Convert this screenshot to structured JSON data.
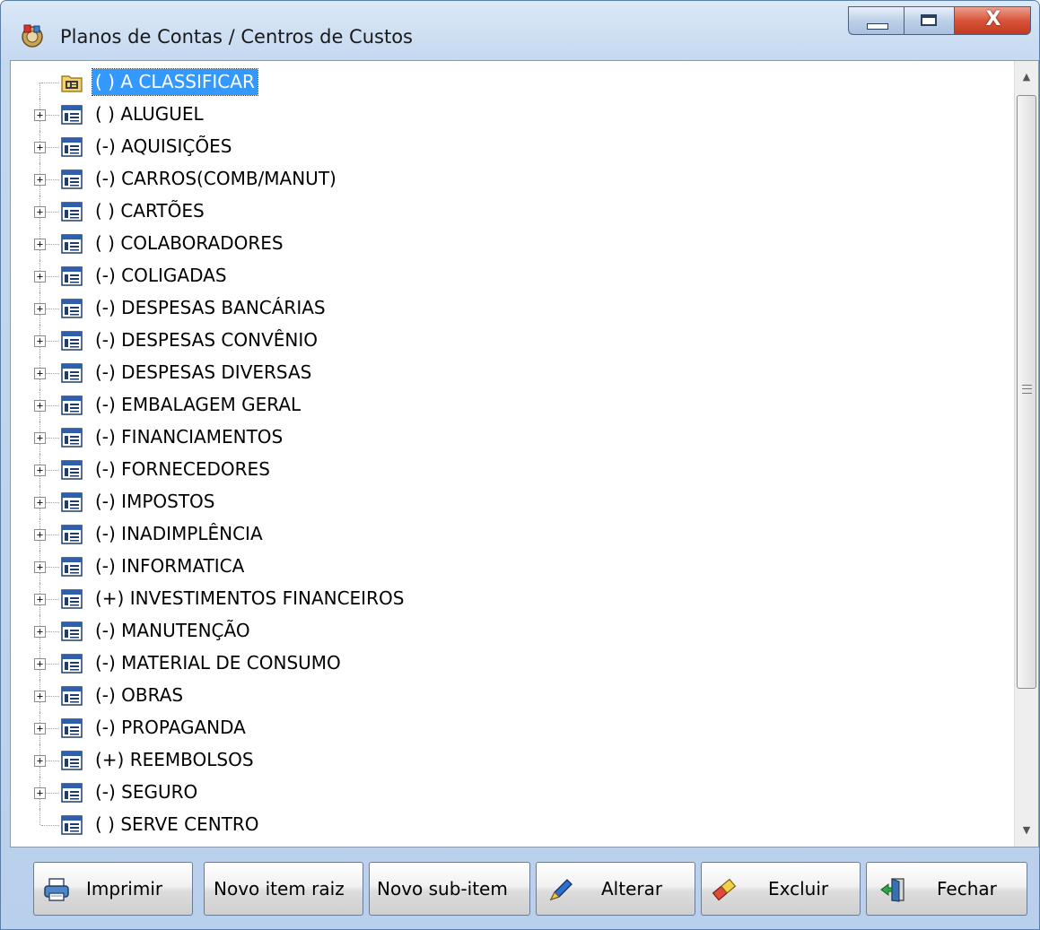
{
  "window": {
    "title": "Planos de Contas / Centros de Custos",
    "caption_close_glyph": "X"
  },
  "tree": {
    "items": [
      {
        "label": "( ) A CLASSIFICAR",
        "expandable": false,
        "selected": true,
        "icon": "folder-icon"
      },
      {
        "label": "( ) ALUGUEL",
        "expandable": true,
        "selected": false,
        "icon": "table-icon"
      },
      {
        "label": "(-) AQUISIÇÕES",
        "expandable": true,
        "selected": false,
        "icon": "table-icon"
      },
      {
        "label": "(-) CARROS(COMB/MANUT)",
        "expandable": true,
        "selected": false,
        "icon": "table-icon"
      },
      {
        "label": "( ) CARTÕES",
        "expandable": true,
        "selected": false,
        "icon": "table-icon"
      },
      {
        "label": "( ) COLABORADORES",
        "expandable": true,
        "selected": false,
        "icon": "table-icon"
      },
      {
        "label": "(-) COLIGADAS",
        "expandable": true,
        "selected": false,
        "icon": "table-icon"
      },
      {
        "label": "(-) DESPESAS BANCÁRIAS",
        "expandable": true,
        "selected": false,
        "icon": "table-icon"
      },
      {
        "label": "(-) DESPESAS CONVÊNIO",
        "expandable": true,
        "selected": false,
        "icon": "table-icon"
      },
      {
        "label": "(-) DESPESAS DIVERSAS",
        "expandable": true,
        "selected": false,
        "icon": "table-icon"
      },
      {
        "label": "(-) EMBALAGEM GERAL",
        "expandable": true,
        "selected": false,
        "icon": "table-icon"
      },
      {
        "label": "(-) FINANCIAMENTOS",
        "expandable": true,
        "selected": false,
        "icon": "table-icon"
      },
      {
        "label": "(-) FORNECEDORES",
        "expandable": true,
        "selected": false,
        "icon": "table-icon"
      },
      {
        "label": "(-) IMPOSTOS",
        "expandable": true,
        "selected": false,
        "icon": "table-icon"
      },
      {
        "label": "(-) INADIMPLÊNCIA",
        "expandable": true,
        "selected": false,
        "icon": "table-icon"
      },
      {
        "label": "(-) INFORMATICA",
        "expandable": true,
        "selected": false,
        "icon": "table-icon"
      },
      {
        "label": "(+) INVESTIMENTOS FINANCEIROS",
        "expandable": true,
        "selected": false,
        "icon": "table-icon"
      },
      {
        "label": "(-) MANUTENÇÃO",
        "expandable": true,
        "selected": false,
        "icon": "table-icon"
      },
      {
        "label": "(-) MATERIAL DE CONSUMO",
        "expandable": true,
        "selected": false,
        "icon": "table-icon"
      },
      {
        "label": "(-) OBRAS",
        "expandable": true,
        "selected": false,
        "icon": "table-icon"
      },
      {
        "label": "(-) PROPAGANDA",
        "expandable": true,
        "selected": false,
        "icon": "table-icon"
      },
      {
        "label": "(+) REEMBOLSOS",
        "expandable": true,
        "selected": false,
        "icon": "table-icon"
      },
      {
        "label": "(-) SEGURO",
        "expandable": true,
        "selected": false,
        "icon": "table-icon"
      },
      {
        "label": "( ) SERVE CENTRO",
        "expandable": false,
        "selected": false,
        "icon": "table-icon"
      }
    ],
    "expander_glyph": "+"
  },
  "buttons": {
    "imprimir": "Imprimir",
    "novo_item_raiz": "Novo item raiz",
    "novo_sub_item": "Novo sub-item",
    "alterar": "Alterar",
    "excluir": "Excluir",
    "fechar": "Fechar"
  },
  "colors": {
    "selection": "#3399ff",
    "close_button": "#c13a1f",
    "title_bar": "#c4d8f0"
  }
}
